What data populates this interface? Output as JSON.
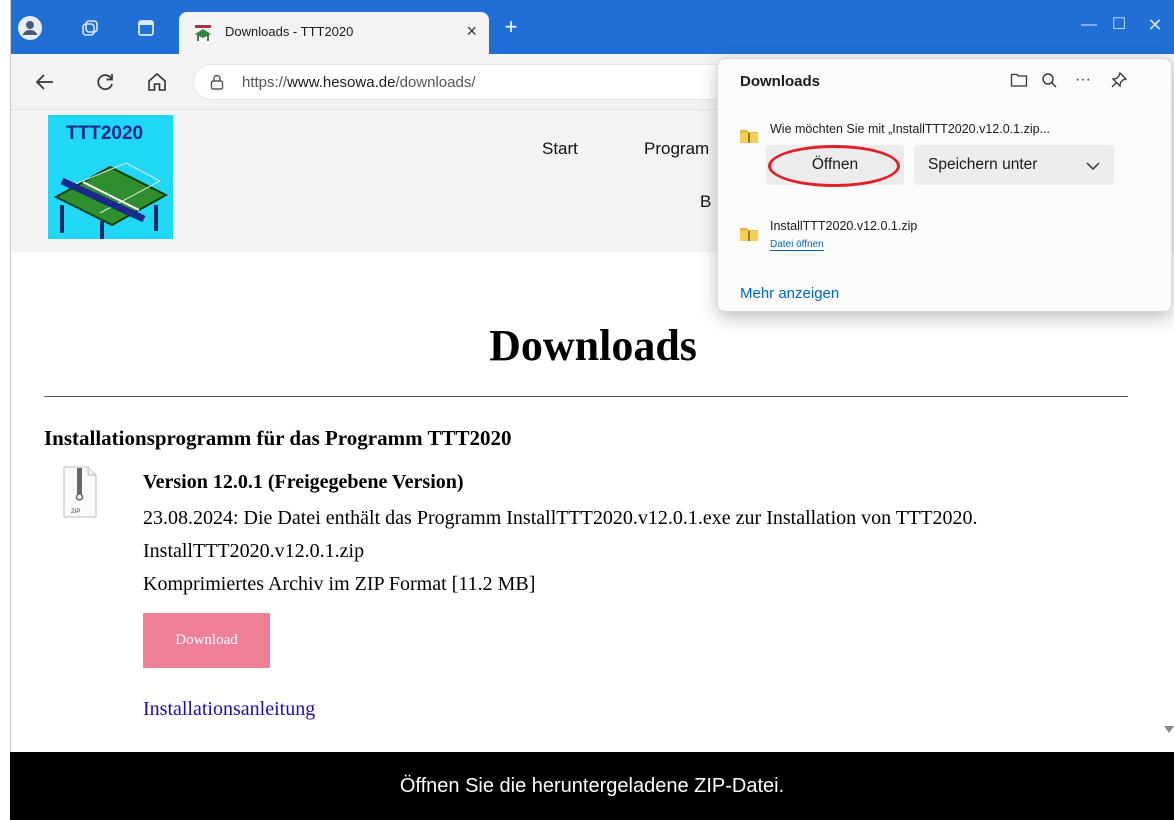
{
  "browser": {
    "tab_title": "Downloads - TTT2020",
    "url_prefix": "https://",
    "url_domain": "www.hesowa.de",
    "url_path": "/downloads/",
    "new_tab": "+",
    "tab_close": "×",
    "minimize": "—",
    "maximize": "☐",
    "close": "✕"
  },
  "site": {
    "logo_text": "TTT2020",
    "nav": {
      "start": "Start",
      "programm": "Program",
      "b": "B"
    }
  },
  "main": {
    "heading": "Downloads",
    "section_title": "Installationsprogramm für das Programm TTT2020",
    "version_title": "Version 12.0.1 (Freigegebene Version)",
    "description": "23.08.2024: Die Datei enthält das Programm InstallTTT2020.v12.0.1.exe zur Installation von TTT2020.",
    "filename": "InstallTTT2020.v12.0.1.zip",
    "archive_info": "Komprimiertes Archiv im ZIP Format [11.2 MB]",
    "download_button": "Download",
    "install_link": "Installationsanleitung",
    "zip_label": "ZIP"
  },
  "downloads_panel": {
    "title": "Downloads",
    "prompt": "Wie möchten Sie mit „InstallTTT2020.v12.0.1.zip...",
    "open_button": "Öffnen",
    "save_as_button": "Speichern unter",
    "completed_file": "InstallTTT2020.v12.0.1.zip",
    "open_file_link": "Datei öffnen",
    "show_more": "Mehr anzeigen",
    "more_icon": "···"
  },
  "caption": "Öffnen Sie die heruntergeladene ZIP-Datei.",
  "colors": {
    "titlebar": "#1f6fd6",
    "download_button": "#ee7f97",
    "logo_bg": "#20d8f6",
    "highlight_ring": "#e0202a",
    "link": "#0067b8"
  }
}
